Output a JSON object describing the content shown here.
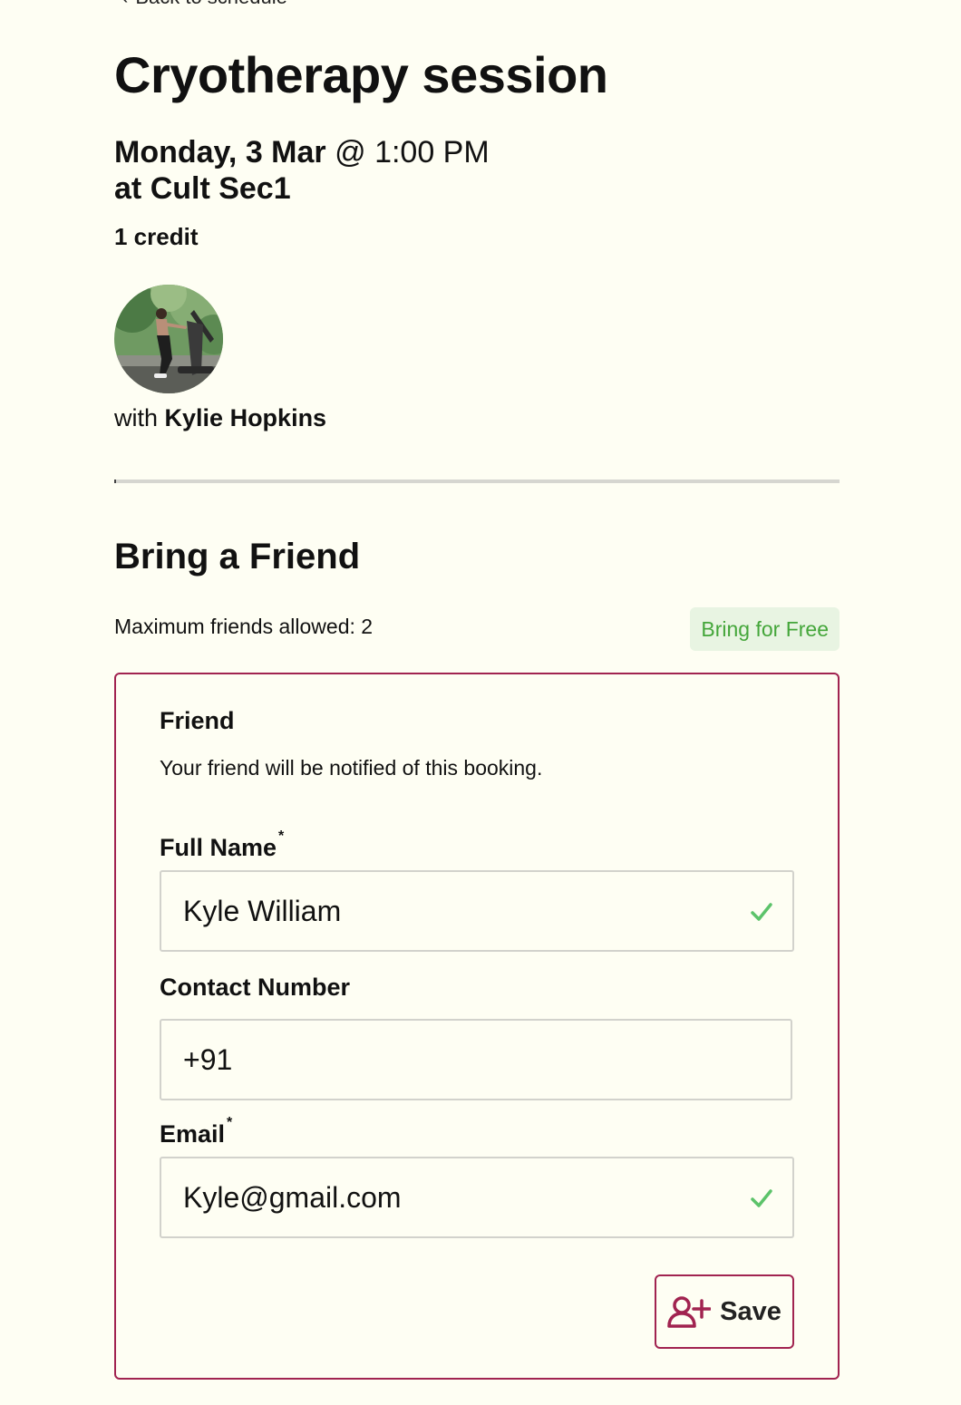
{
  "nav": {
    "back_label": "Back to schedule"
  },
  "session": {
    "title": "Cryotherapy session",
    "date": "Monday, 3 Mar",
    "time_separator": " @ ",
    "time": "1:00 PM",
    "location_prefix": "at ",
    "location": "Cult Sec1",
    "credits": "1 credit",
    "instructor_prefix": "with ",
    "instructor_name": "Kylie Hopkins"
  },
  "bring_friend": {
    "title": "Bring a Friend",
    "max_friends_label": "Maximum friends allowed: 2",
    "badge": "Bring for Free",
    "card": {
      "heading": "Friend",
      "note": "Your friend will be notified of this booking.",
      "full_name": {
        "label": "Full Name",
        "required_mark": "*",
        "value": "Kyle William",
        "valid": true
      },
      "contact": {
        "label": "Contact Number",
        "value": "+91"
      },
      "email": {
        "label": "Email",
        "required_mark": "*",
        "value": "Kyle@gmail.com",
        "valid": true
      },
      "save_label": "Save"
    }
  },
  "icons": {
    "back": "chevron-left-icon",
    "valid": "check-icon",
    "save": "add-user-icon"
  },
  "colors": {
    "background": "#fefef3",
    "accent": "#a12350",
    "success": "#44a63a",
    "success_bg": "#e8f4e2",
    "valid_check": "#5cc36a"
  }
}
